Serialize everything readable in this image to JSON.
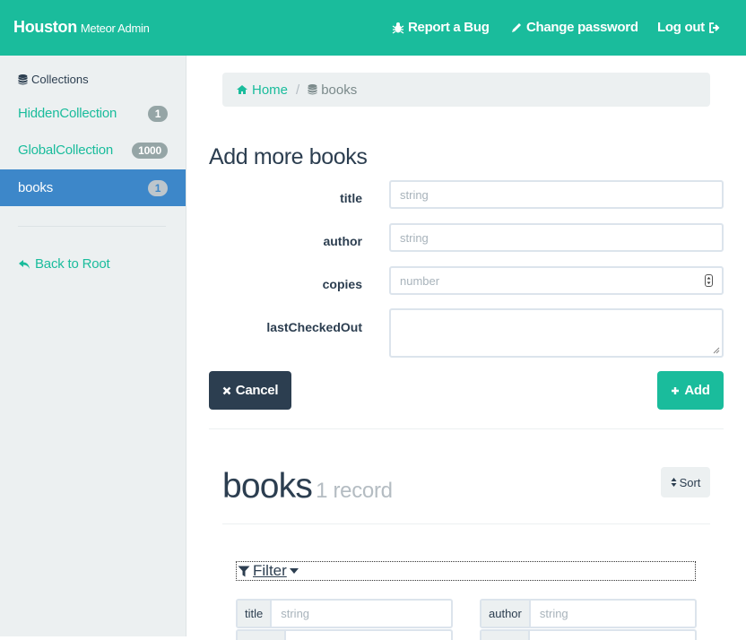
{
  "navbar": {
    "brand": "Houston",
    "brand_sub": "Meteor Admin",
    "report_bug": "Report a Bug",
    "change_password": "Change password",
    "logout": "Log out"
  },
  "sidebar": {
    "heading": "Collections",
    "items": [
      {
        "label": "HiddenCollection",
        "count": "1"
      },
      {
        "label": "GlobalCollection",
        "count": "1000"
      },
      {
        "label": "books",
        "count": "1",
        "active": true
      }
    ],
    "back_label": "Back to Root"
  },
  "breadcrumb": {
    "home": "Home",
    "current": "books"
  },
  "form": {
    "title": "Add more books",
    "fields": [
      {
        "label": "title",
        "placeholder": "string"
      },
      {
        "label": "author",
        "placeholder": "string"
      },
      {
        "label": "copies",
        "placeholder": "number"
      },
      {
        "label": "lastCheckedOut",
        "placeholder": ""
      }
    ],
    "cancel_label": "Cancel",
    "add_label": "Add"
  },
  "collection": {
    "name": "books",
    "count_label": "1 record",
    "sort_label": "Sort",
    "filter_label": "Filter",
    "filters": [
      {
        "label": "title",
        "placeholder": "string"
      },
      {
        "label": "author",
        "placeholder": "string"
      }
    ]
  },
  "colors": {
    "primary": "#1abc9c",
    "dark": "#2c3e50",
    "active": "#3d87c9",
    "light": "#ecf0f1"
  }
}
